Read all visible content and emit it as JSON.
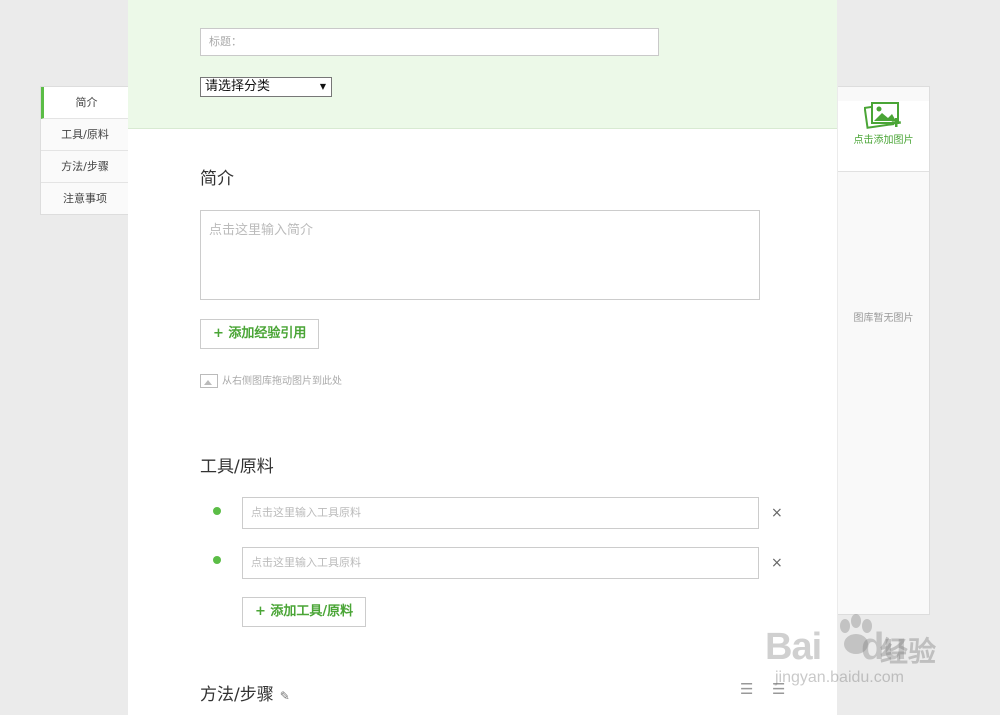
{
  "left_nav": {
    "items": [
      {
        "label": "简介",
        "active": true
      },
      {
        "label": "工具/原料",
        "active": false
      },
      {
        "label": "方法/步骤",
        "active": false
      },
      {
        "label": "注意事项",
        "active": false
      }
    ]
  },
  "header": {
    "title_placeholder": "标题：",
    "category_selected": "请选择分类"
  },
  "intro": {
    "heading": "简介",
    "placeholder": "点击这里输入简介",
    "add_reference_label": "+  添加经验引用",
    "drag_hint": "从右侧图库拖动图片到此处"
  },
  "tools": {
    "heading": "工具/原料",
    "items": [
      {
        "placeholder": "点击这里输入工具原料"
      },
      {
        "placeholder": "点击这里输入工具原料"
      }
    ],
    "delete_glyph": "×",
    "add_label": "+  添加工具/原料"
  },
  "steps": {
    "heading": "方法/步骤"
  },
  "gallery": {
    "add_label": "点击添加图片",
    "empty_label": "图库暂无图片"
  },
  "watermark": {
    "brand": "Bai",
    "brand2": "du",
    "text": "经验",
    "url": "jingyan.baidu.com"
  },
  "colors": {
    "accent": "#5bbd46",
    "top_bg": "#ecf9e8"
  }
}
